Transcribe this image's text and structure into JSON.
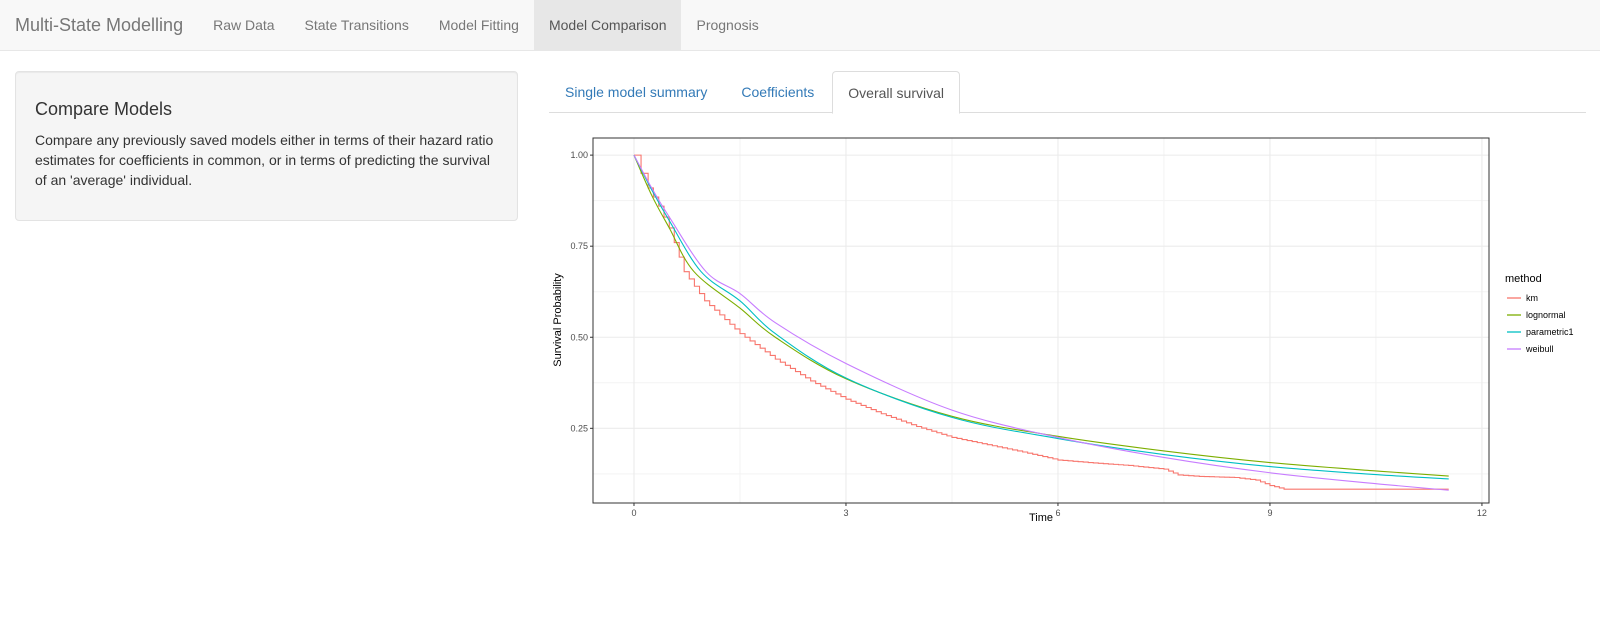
{
  "navbar": {
    "brand": "Multi-State Modelling",
    "items": [
      {
        "label": "Raw Data",
        "active": false
      },
      {
        "label": "State Transitions",
        "active": false
      },
      {
        "label": "Model Fitting",
        "active": false
      },
      {
        "label": "Model Comparison",
        "active": true
      },
      {
        "label": "Prognosis",
        "active": false
      }
    ]
  },
  "sidebar": {
    "title": "Compare Models",
    "description": "Compare any previously saved models either in terms of their hazard ratio estimates for coefficients in common, or in terms of predicting the survival of an 'average' individual."
  },
  "tabs": [
    {
      "label": "Single model summary",
      "active": false
    },
    {
      "label": "Coefficients",
      "active": false
    },
    {
      "label": "Overall survival",
      "active": true
    }
  ],
  "chart_data": {
    "type": "line",
    "title": "",
    "xlabel": "Time",
    "ylabel": "Survival Probability",
    "xlim": [
      -0.58,
      12.1
    ],
    "ylim": [
      0.045,
      1.047
    ],
    "xticks": [
      0,
      3,
      6,
      9,
      12
    ],
    "yticks": [
      0.25,
      0.5,
      0.75,
      1.0
    ],
    "ytick_labels": [
      "0.25",
      "0.50",
      "0.75",
      "1.00"
    ],
    "grid": true,
    "legend": {
      "title": "method",
      "position": "right"
    },
    "series": [
      {
        "name": "km",
        "color": "#F8766D",
        "step": true,
        "x": [
          0,
          0.1,
          0.2,
          0.35,
          0.5,
          0.71,
          1.0,
          1.5,
          2.0,
          2.5,
          3.0,
          3.5,
          4.0,
          4.5,
          5.0,
          5.5,
          6.0,
          6.5,
          7.0,
          7.5,
          7.7,
          8.0,
          8.5,
          8.8,
          9.0,
          9.2,
          10.0,
          11.53
        ],
        "y": [
          1.0,
          0.95,
          0.91,
          0.86,
          0.8,
          0.68,
          0.6,
          0.51,
          0.44,
          0.38,
          0.33,
          0.29,
          0.255,
          0.225,
          0.205,
          0.185,
          0.163,
          0.155,
          0.148,
          0.138,
          0.122,
          0.118,
          0.115,
          0.108,
          0.093,
          0.083,
          0.083,
          0.083
        ]
      },
      {
        "name": "lognormal",
        "color": "#7CAE00",
        "x": [
          0,
          0.25,
          0.5,
          0.85,
          1.5,
          2.0,
          3.0,
          4.5,
          6.0,
          7.5,
          9.0,
          10.5,
          11.53
        ],
        "y": [
          1.0,
          0.89,
          0.8,
          0.68,
          0.58,
          0.5,
          0.386,
          0.283,
          0.228,
          0.188,
          0.156,
          0.133,
          0.119
        ]
      },
      {
        "name": "parametric1",
        "color": "#00BFC4",
        "x": [
          0,
          0.25,
          0.5,
          0.95,
          1.5,
          2.0,
          3.0,
          4.5,
          6.0,
          7.5,
          9.0,
          10.5,
          11.53
        ],
        "y": [
          1.0,
          0.905,
          0.82,
          0.68,
          0.6,
          0.51,
          0.388,
          0.28,
          0.222,
          0.178,
          0.145,
          0.123,
          0.111
        ]
      },
      {
        "name": "weibull",
        "color": "#C77CFF",
        "x": [
          0,
          0.25,
          0.5,
          1.02,
          1.5,
          2.0,
          3.0,
          4.5,
          6.0,
          7.5,
          9.0,
          10.5,
          11.53
        ],
        "y": [
          1.0,
          0.91,
          0.83,
          0.68,
          0.62,
          0.54,
          0.428,
          0.3,
          0.225,
          0.17,
          0.128,
          0.098,
          0.08
        ]
      }
    ]
  }
}
